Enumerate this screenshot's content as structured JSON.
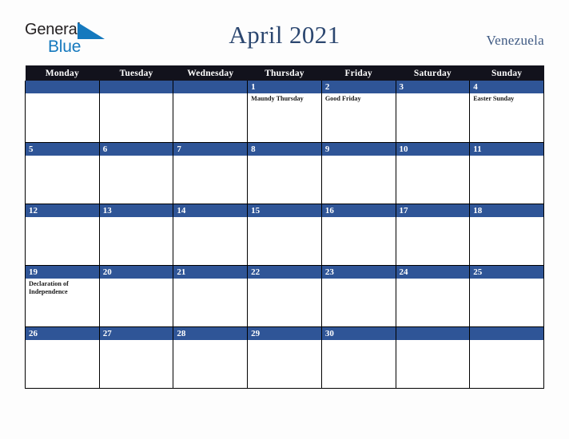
{
  "brand": {
    "name_part1": "General",
    "name_part2": "Blue",
    "triangle_icon": "blue-triangle-icon",
    "color_dark": "#231f20",
    "color_blue": "#1579be"
  },
  "header": {
    "title": "April 2021",
    "country": "Venezuela",
    "title_color": "#2c4770"
  },
  "calendar": {
    "month": "April",
    "year": "2021",
    "header_bg": "#12121c",
    "day_bar_bg": "#2f5597",
    "weekdays": [
      "Monday",
      "Tuesday",
      "Wednesday",
      "Thursday",
      "Friday",
      "Saturday",
      "Sunday"
    ],
    "weeks": [
      [
        {
          "date": "",
          "holiday": ""
        },
        {
          "date": "",
          "holiday": ""
        },
        {
          "date": "",
          "holiday": ""
        },
        {
          "date": "1",
          "holiday": "Maundy Thursday"
        },
        {
          "date": "2",
          "holiday": "Good Friday"
        },
        {
          "date": "3",
          "holiday": ""
        },
        {
          "date": "4",
          "holiday": "Easter Sunday"
        }
      ],
      [
        {
          "date": "5",
          "holiday": ""
        },
        {
          "date": "6",
          "holiday": ""
        },
        {
          "date": "7",
          "holiday": ""
        },
        {
          "date": "8",
          "holiday": ""
        },
        {
          "date": "9",
          "holiday": ""
        },
        {
          "date": "10",
          "holiday": ""
        },
        {
          "date": "11",
          "holiday": ""
        }
      ],
      [
        {
          "date": "12",
          "holiday": ""
        },
        {
          "date": "13",
          "holiday": ""
        },
        {
          "date": "14",
          "holiday": ""
        },
        {
          "date": "15",
          "holiday": ""
        },
        {
          "date": "16",
          "holiday": ""
        },
        {
          "date": "17",
          "holiday": ""
        },
        {
          "date": "18",
          "holiday": ""
        }
      ],
      [
        {
          "date": "19",
          "holiday": "Declaration of Independence"
        },
        {
          "date": "20",
          "holiday": ""
        },
        {
          "date": "21",
          "holiday": ""
        },
        {
          "date": "22",
          "holiday": ""
        },
        {
          "date": "23",
          "holiday": ""
        },
        {
          "date": "24",
          "holiday": ""
        },
        {
          "date": "25",
          "holiday": ""
        }
      ],
      [
        {
          "date": "26",
          "holiday": ""
        },
        {
          "date": "27",
          "holiday": ""
        },
        {
          "date": "28",
          "holiday": ""
        },
        {
          "date": "29",
          "holiday": ""
        },
        {
          "date": "30",
          "holiday": ""
        },
        {
          "date": "",
          "holiday": ""
        },
        {
          "date": "",
          "holiday": ""
        }
      ]
    ]
  }
}
